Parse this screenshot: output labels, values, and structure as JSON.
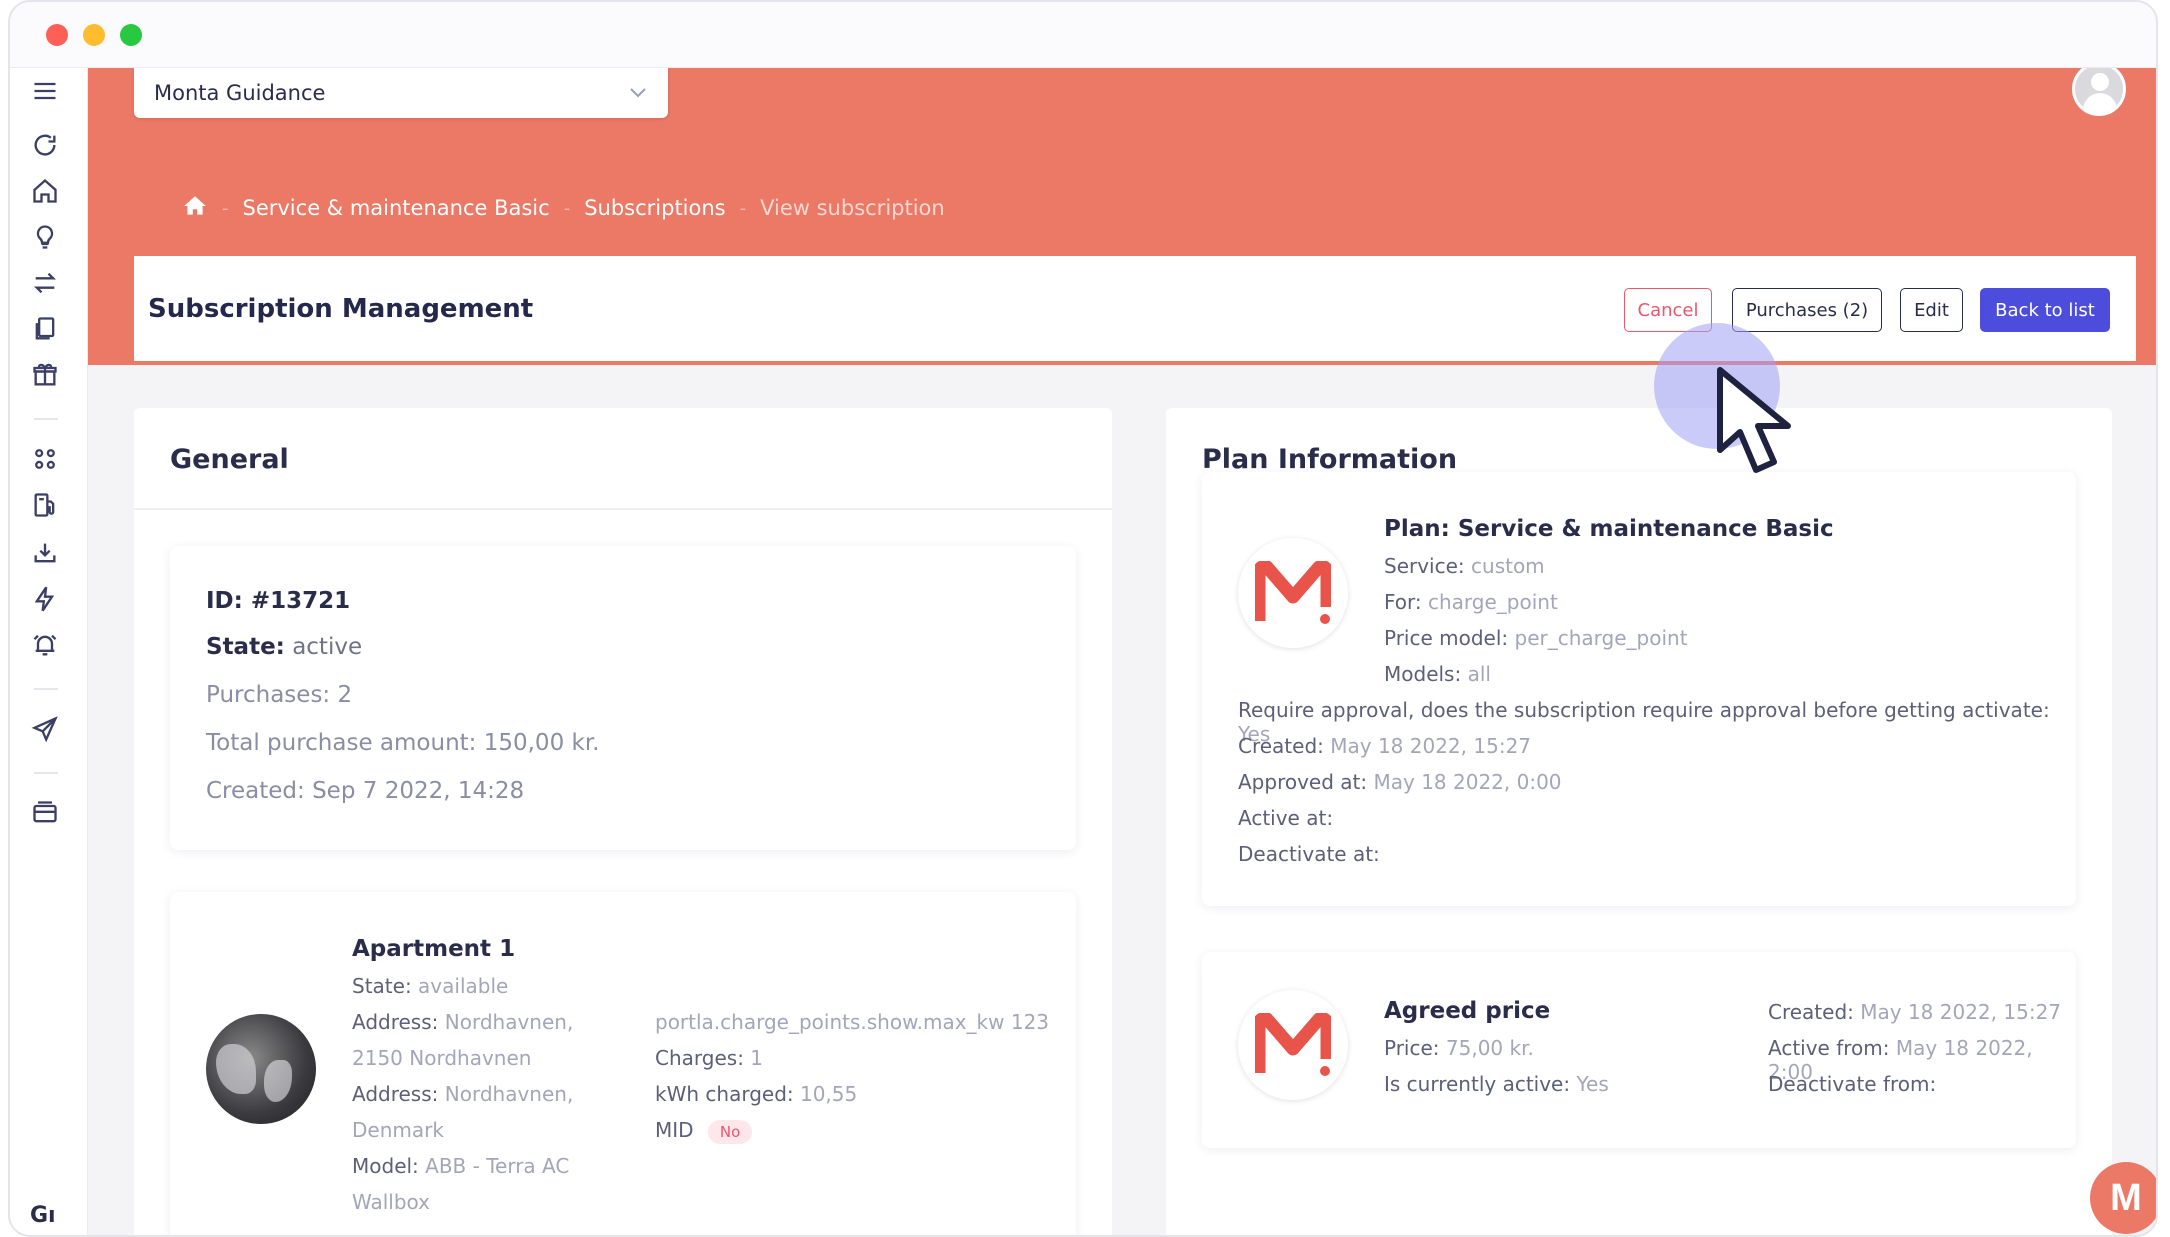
{
  "org_select": {
    "value": "Monta Guidance"
  },
  "breadcrumb": {
    "items": [
      "Service & maintenance Basic",
      "Subscriptions",
      "View subscription"
    ]
  },
  "header": {
    "title": "Subscription Management",
    "buttons": {
      "cancel": "Cancel",
      "purchases": "Purchases (2)",
      "edit": "Edit",
      "back": "Back to list"
    }
  },
  "general": {
    "title": "General",
    "id_label": "ID: #13721",
    "state_label": "State:",
    "state_value": "active",
    "purchases": "Purchases: 2",
    "total": "Total purchase amount: 150,00 kr.",
    "created": "Created: Sep 7 2022, 14:28"
  },
  "apartment": {
    "name": "Apartment 1",
    "state_label": "State:",
    "state_value": "available",
    "address1_label": "Address:",
    "address1_value_a": "Nordhavnen,",
    "address1_value_b": "2150 Nordhavnen",
    "address2_label": "Address:",
    "address2_value_a": "Nordhavnen,",
    "address2_value_b": "Denmark",
    "model_label": "Model:",
    "model_value_a": "ABB - Terra AC",
    "model_value_b": "Wallbox",
    "maxkw_label": "portla.charge_points.show.max_kw",
    "maxkw_value": "123",
    "charges_label": "Charges:",
    "charges_value": "1",
    "kwh_label": "kWh charged:",
    "kwh_value": "10,55",
    "mid_label": "MID",
    "mid_badge": "No"
  },
  "plan": {
    "title": "Plan Information",
    "name": "Plan: Service & maintenance Basic",
    "service_label": "Service:",
    "service_value": "custom",
    "for_label": "For:",
    "for_value": "charge_point",
    "price_model_label": "Price model:",
    "price_model_value": "per_charge_point",
    "models_label": "Models:",
    "models_value": "all",
    "approval_label": "Require approval, does the subscription require approval before getting activate:",
    "approval_value": "Yes",
    "created_label": "Created:",
    "created_value": "May 18 2022, 15:27",
    "approved_label": "Approved at:",
    "approved_value": "May 18 2022, 0:00",
    "active_label": "Active at:",
    "deactivate_label": "Deactivate at:"
  },
  "agreed_price": {
    "title": "Agreed price",
    "price_label": "Price:",
    "price_value": "75,00 kr.",
    "current_label": "Is currently active:",
    "current_value": "Yes",
    "created_label": "Created:",
    "created_value": "May 18 2022, 15:27",
    "active_from_label": "Active from:",
    "active_from_value": "May 18 2022, 2:00",
    "deactivate_label": "Deactivate from:"
  },
  "sidebar": {
    "icons": [
      "menu-icon",
      "refresh-icon",
      "home-icon",
      "lightbulb-icon",
      "transfer-icon",
      "documents-icon",
      "gift-icon",
      "grid-icon",
      "fuel-station-icon",
      "download-icon",
      "bolt-icon",
      "alarm-icon",
      "send-icon",
      "cards-icon"
    ],
    "bottom_label": "Gı"
  },
  "chat_fab": {
    "label": "M"
  },
  "colors": {
    "brand": "#ec7866",
    "primary": "#4c4ddc",
    "danger": "#e9576e"
  }
}
